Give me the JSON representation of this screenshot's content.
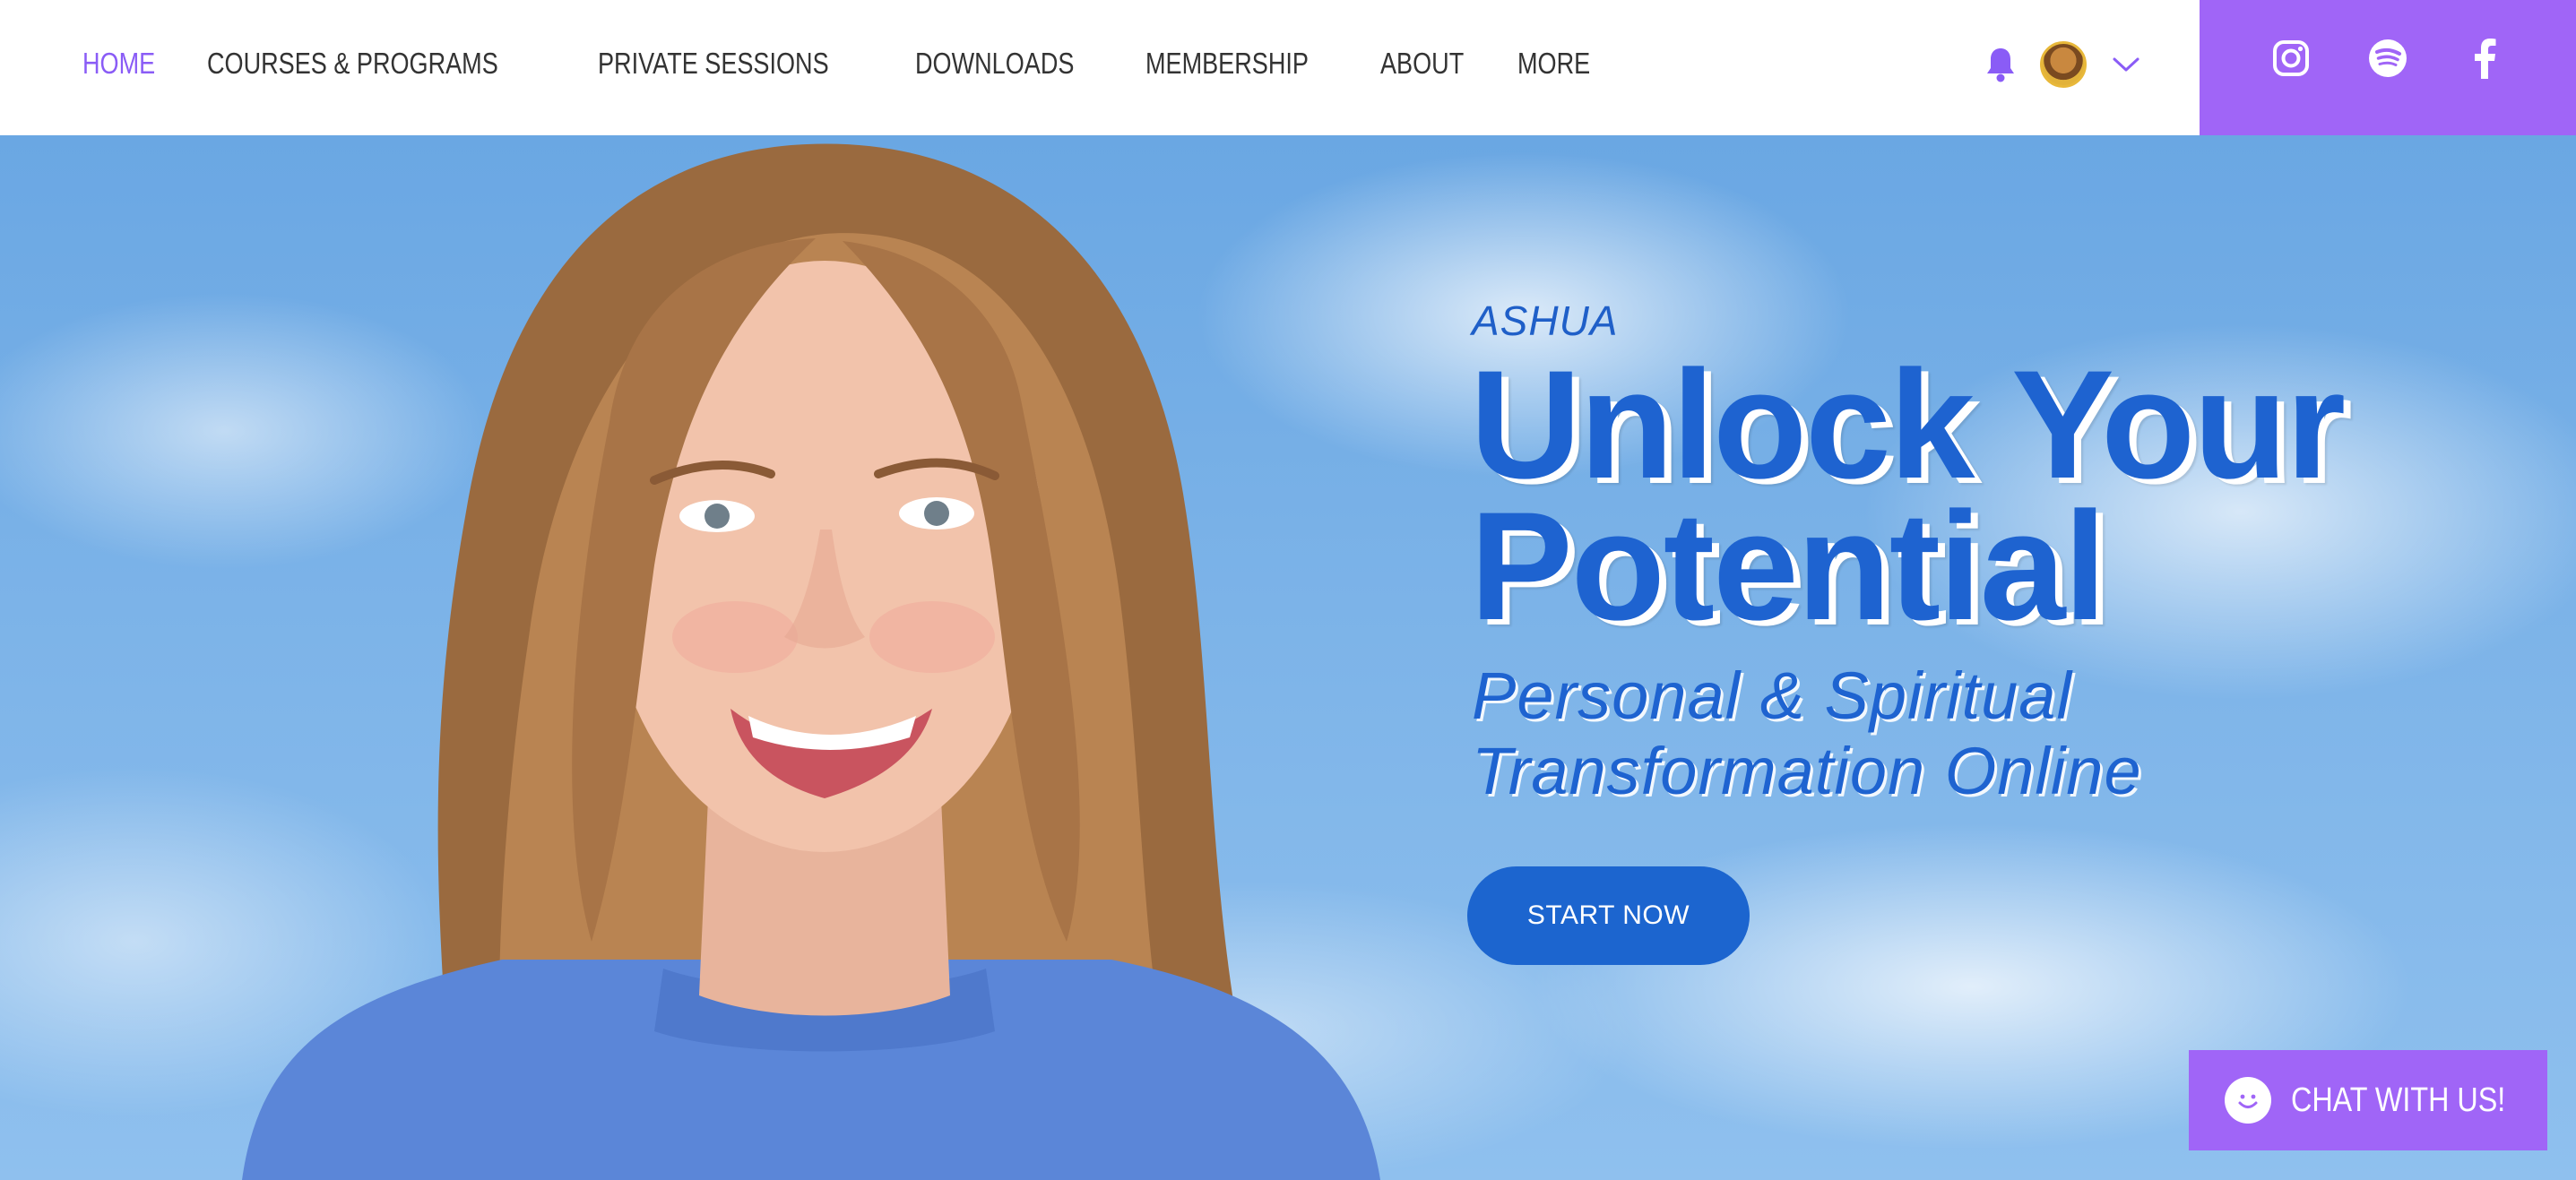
{
  "nav": {
    "items": [
      {
        "label": "HOME",
        "active": true
      },
      {
        "label": "COURSES & PROGRAMS",
        "active": false
      },
      {
        "label": "PRIVATE SESSIONS",
        "active": false
      },
      {
        "label": "DOWNLOADS",
        "active": false
      },
      {
        "label": "MEMBERSHIP",
        "active": false
      },
      {
        "label": "ABOUT",
        "active": false
      },
      {
        "label": "MORE",
        "active": false
      }
    ]
  },
  "user": {
    "icons": [
      "bell-icon",
      "avatar",
      "chevron-down-icon"
    ]
  },
  "social": {
    "icons": [
      "instagram-icon",
      "spotify-icon",
      "facebook-icon"
    ]
  },
  "hero": {
    "eyebrow": "ASHUA",
    "headline_line1": "Unlock Your",
    "headline_line2": "Potential",
    "subhead_line1": "Personal & Spiritual",
    "subhead_line2": "Transformation Online",
    "cta_label": "START NOW"
  },
  "chat": {
    "label": "CHAT WITH US!"
  },
  "colors": {
    "accent_purple": "#a065f7",
    "nav_active": "#8a5cf6",
    "brand_blue": "#1e63d0",
    "sky_blue": "#7cb3e8"
  }
}
